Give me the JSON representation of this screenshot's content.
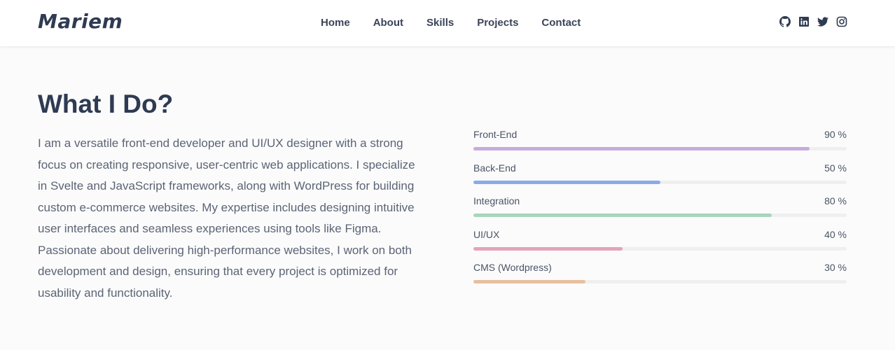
{
  "header": {
    "logo": "Mariem",
    "nav": [
      "Home",
      "About",
      "Skills",
      "Projects",
      "Contact"
    ],
    "social": [
      "github-icon",
      "linkedin-icon",
      "twitter-icon",
      "instagram-icon"
    ]
  },
  "main": {
    "title": "What I Do?",
    "description": "I am a versatile front-end developer and UI/UX designer with a strong focus on creating responsive, user-centric web applications. I specialize in Svelte and JavaScript frameworks, along with WordPress for building custom e-commerce websites. My expertise includes designing intuitive user interfaces and seamless experiences using tools like Figma. Passionate about delivering high-performance websites, I work on both development and design, ensuring that every project is optimized for usability and functionality."
  },
  "skills": [
    {
      "name": "Front-End",
      "value": 90,
      "label": "90 %",
      "color": "#c9aadd"
    },
    {
      "name": "Back-End",
      "value": 50,
      "label": "50 %",
      "color": "#8aaae9"
    },
    {
      "name": "Integration",
      "value": 80,
      "label": "80 %",
      "color": "#a9d5bd"
    },
    {
      "name": "UI/UX",
      "value": 40,
      "label": "40 %",
      "color": "#e5a3b7"
    },
    {
      "name": "CMS (Wordpress)",
      "value": 30,
      "label": "30 %",
      "color": "#e7c09e"
    }
  ]
}
